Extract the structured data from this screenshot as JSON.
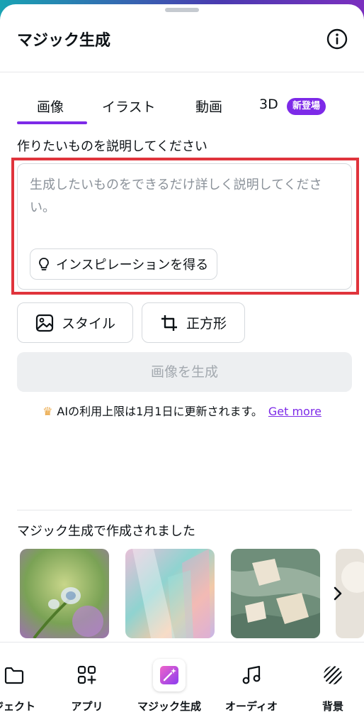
{
  "header": {
    "title": "マジック生成",
    "info_icon": "info-circle-icon"
  },
  "tabs": [
    {
      "label": "画像",
      "active": true
    },
    {
      "label": "イラスト",
      "active": false
    },
    {
      "label": "動画",
      "active": false
    },
    {
      "label": "3D",
      "active": false,
      "badge": "新登場"
    }
  ],
  "prompt": {
    "label": "作りたいものを説明してください",
    "placeholder": "生成したいものをできるだけ詳しく説明してください。",
    "inspiration_button": "インスピレーションを得る"
  },
  "options": {
    "style_button": "スタイル",
    "aspect_button": "正方形"
  },
  "generate_button": "画像を生成",
  "limit": {
    "text": "AIの利用上限は1月1日に更新されます。",
    "link": "Get more"
  },
  "gallery": {
    "title": "マジック生成で作成されました"
  },
  "bottom_nav": [
    {
      "label": "ジェクト",
      "icon": "folder-icon"
    },
    {
      "label": "アプリ",
      "icon": "apps-grid-icon"
    },
    {
      "label": "マジック生成",
      "icon": "magic-wand-icon",
      "active": true
    },
    {
      "label": "オーディオ",
      "icon": "music-note-icon"
    },
    {
      "label": "背景",
      "icon": "background-pattern-icon"
    }
  ],
  "colors": {
    "accent": "#7d2ae8",
    "highlight": "#e0343c",
    "crown": "#e9a23b"
  }
}
